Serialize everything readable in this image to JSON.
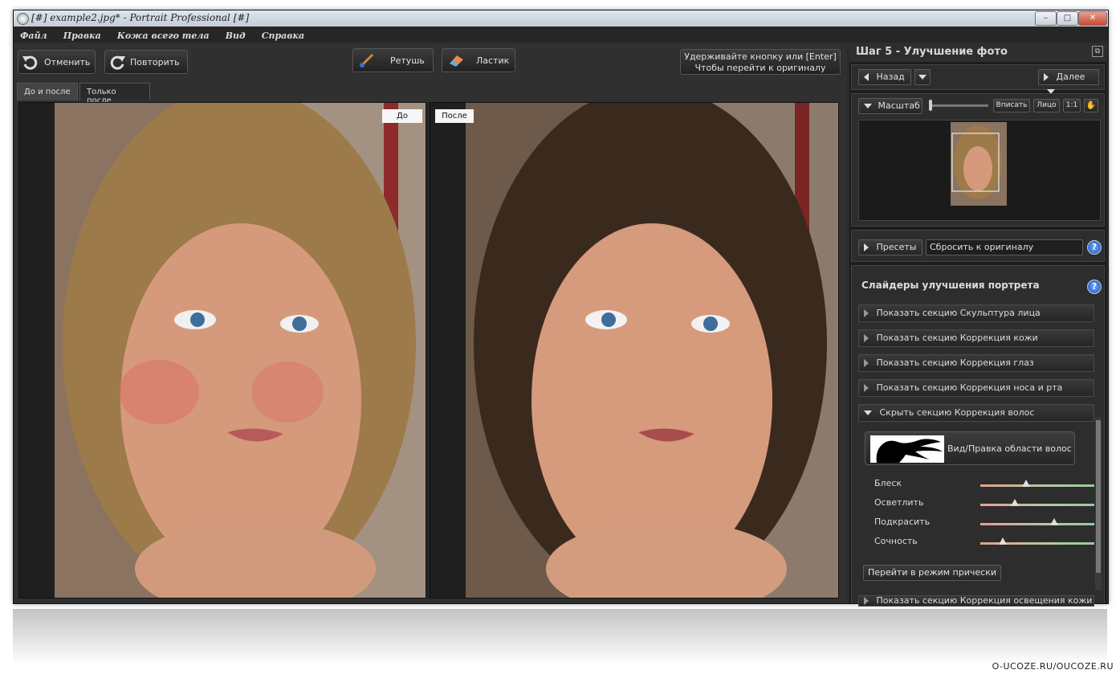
{
  "window": {
    "title": "[#] example2.jpg* - Portrait Professional [#]",
    "controls": {
      "minimize": "–",
      "maximize": "□",
      "close": "✕"
    }
  },
  "menu": [
    "Файл",
    "Правка",
    "Кожа всего тела",
    "Вид",
    "Справка"
  ],
  "toolbar": {
    "undo_label": "Отменить",
    "redo_label": "Повторить",
    "retouch_label": "Ретушь",
    "eraser_label": "Ластик",
    "hint_line1": "Удерживайте кнопку или [Enter]",
    "hint_line2": "Чтобы перейти к оригиналу"
  },
  "tabs": [
    {
      "label": "До и после",
      "active": true
    },
    {
      "label": "Только после",
      "active": false
    }
  ],
  "preview": {
    "before_label": "До",
    "after_label": "После"
  },
  "sidebar": {
    "step_title": "Шаг 5 - Улучшение фото",
    "back_label": "Назад",
    "next_label": "Далее",
    "zoom_label": "Масштаб",
    "fit_label": "Вписать",
    "face_label": "Лицо",
    "one_to_one_label": "1:1",
    "presets_label": "Пресеты",
    "presets_value": "Сбросить к оригиналу",
    "sliders_title": "Слайдеры улучшения портрета",
    "sections": [
      "Показать секцию Скульптура лица",
      "Показать секцию Коррекция кожи",
      "Показать секцию Коррекция глаз",
      "Показать секцию Коррекция носа и рта",
      "Скрыть секцию Коррекция волос"
    ],
    "hair_area_button": "Вид/Правка области волос",
    "hair_sliders": [
      {
        "label": "Блеск",
        "value": 0.4
      },
      {
        "label": "Осветлить",
        "value": 0.3
      },
      {
        "label": "Подкрасить",
        "value": 0.65
      },
      {
        "label": "Сочность",
        "value": 0.2
      }
    ],
    "hairstyle_mode_button": "Перейти в режим прически",
    "last_section": "Показать секцию Коррекция освещения кожи"
  },
  "watermark": "O-UCOZE.RU/OUCOZE.RU",
  "colors": {
    "app_bg": "#2b2b2b",
    "panel_bg": "#2d2d2d",
    "text": "#dddddd",
    "help_blue": "#1f55b8"
  }
}
